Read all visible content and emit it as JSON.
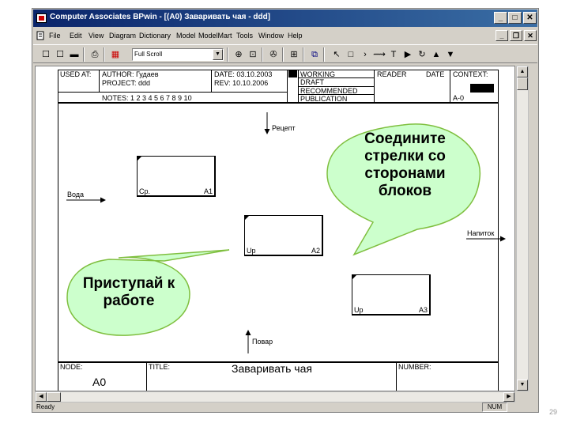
{
  "window": {
    "title": "Computer Associates BPwin - [(A0) Заваривать чая - ddd]",
    "buttons": {
      "minimize": "_",
      "maximize": "□",
      "close": "✕"
    }
  },
  "menu": {
    "items": [
      "File",
      "Edit",
      "View",
      "Diagram",
      "Dictionary",
      "Model",
      "ModelMart",
      "Tools",
      "Window",
      "Help"
    ],
    "mdi_buttons": {
      "minimize": "_",
      "restore": "❐",
      "close": "✕"
    }
  },
  "toolbar": {
    "font_name": "Full Scroll",
    "font_dropdown_icon": "▼",
    "buttons": [
      "☐",
      "☐",
      "▬",
      "⎙",
      "▦",
      "⊕",
      "⊡",
      "✇",
      "⊞",
      "⧉",
      "↖",
      "□",
      "›",
      "⟿",
      "T",
      "▶",
      "↻",
      "▲",
      "▼"
    ],
    "icon_names": [
      "new-file-icon",
      "open-file-icon",
      "save-icon",
      "print-icon",
      "color-icon",
      "zoom-in-icon",
      "zoom-out-icon",
      "scissors-icon",
      "model-explorer-icon",
      "arrange-icon",
      "pointer-icon",
      "activity-box-icon",
      "arrow-icon",
      "squiggle-icon",
      "text-icon",
      "play-icon",
      "rotate-icon",
      "up-icon",
      "down-icon"
    ]
  },
  "header": {
    "used_at": "USED AT:",
    "author": "AUTHOR: Гудаев",
    "project": "PROJECT: ddd",
    "date": "DATE: 03.10.2003",
    "rev": "REV: 10.10.2006",
    "notes": "NOTES: 1 2 3 4 5 6 7 8 9 10",
    "status": [
      "WORKING",
      "DRAFT",
      "RECOMMENDED",
      "PUBLICATION"
    ],
    "reader": "READER",
    "reader_date": "DATE",
    "context": "CONTEXT:",
    "context_code": "A-0"
  },
  "diagram": {
    "arrows": {
      "recipe": "Рецепт",
      "water": "Вода",
      "drink": "Напиток",
      "cook": "Повар"
    },
    "boxes": [
      {
        "code": "Ср.",
        "number": "A1"
      },
      {
        "code": "Up",
        "number": "A2"
      },
      {
        "code": "Up",
        "number": "A3"
      }
    ]
  },
  "callouts": {
    "connect": "Соедините стрелки со сторонами блоков",
    "start": "Приступай к работе"
  },
  "footer": {
    "node": "NODE:",
    "node_value": "A0",
    "title": "TITLE:",
    "title_value": "Заваривать чая",
    "number": "NUMBER:"
  },
  "scroll": {
    "up": "▲",
    "down": "▼",
    "left": "◀",
    "right": "▶"
  },
  "status": {
    "ready": "Ready",
    "num": "NUM"
  },
  "slide_number": "29"
}
